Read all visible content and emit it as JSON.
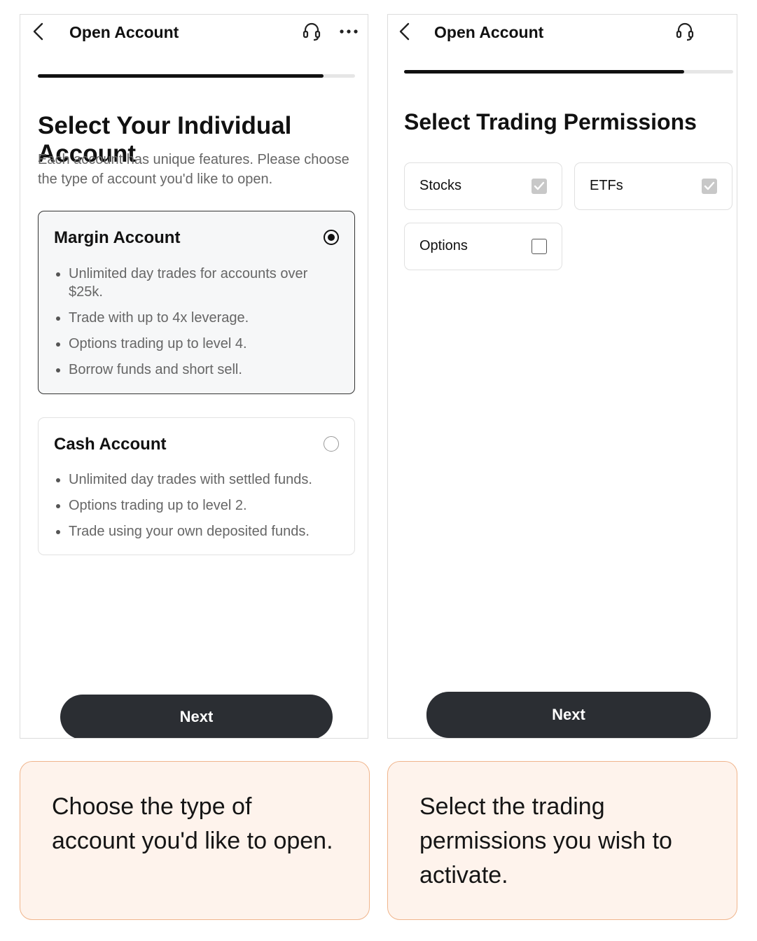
{
  "screen1": {
    "header": {
      "title": "Open Account",
      "back_icon": "chevron-left-icon",
      "support_icon": "headset-icon",
      "more_icon": "more-horizontal-icon"
    },
    "progress": 0.9,
    "heading": "Select Your Individual Account",
    "subheading": "Each account has unique features. Please choose the type of account you'd like to open.",
    "accounts": [
      {
        "title": "Margin Account",
        "selected": true,
        "features": [
          "Unlimited day trades for accounts over $25k.",
          "Trade with up to 4x leverage.",
          "Options trading up to level 4.",
          "Borrow funds and short sell."
        ]
      },
      {
        "title": "Cash Account",
        "selected": false,
        "features": [
          "Unlimited day trades with settled funds.",
          "Options trading up to level 2.",
          "Trade using your own deposited funds."
        ]
      }
    ],
    "next_label": "Next"
  },
  "screen2": {
    "header": {
      "title": "Open Account",
      "back_icon": "chevron-left-icon",
      "support_icon": "headset-icon"
    },
    "progress": 0.85,
    "heading": "Select Trading Permissions",
    "permissions": [
      {
        "label": "Stocks",
        "checked": true
      },
      {
        "label": "ETFs",
        "checked": true
      },
      {
        "label": "Options",
        "checked": false
      }
    ],
    "next_label": "Next"
  },
  "captions": {
    "left": "Choose the type of account you'd like to open.",
    "right": "Select the trading permissions you wish to activate."
  },
  "colors": {
    "button": "#2b2e33",
    "caption_bg": "#fef3ec",
    "caption_border": "#f0b58c"
  }
}
